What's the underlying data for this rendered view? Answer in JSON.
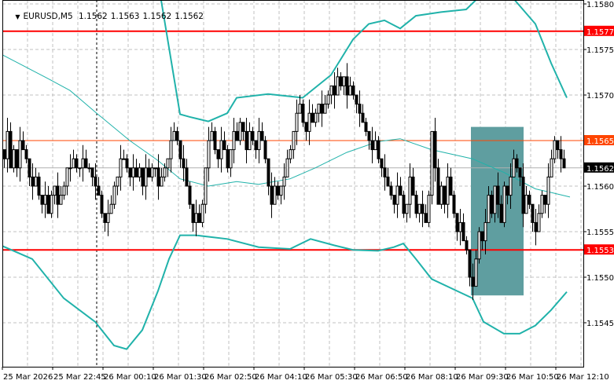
{
  "header": {
    "menu_icon": "triangle-down-icon",
    "symbol": "EURUSD,M5",
    "open": "1.1562",
    "high": "1.1563",
    "low": "1.1562",
    "close": "1.1562"
  },
  "chart_data": {
    "type": "candlestick",
    "symbol": "EURUSD",
    "timeframe": "M5",
    "ylim": [
      1.15403,
      1.15804
    ],
    "y_ticks": [
      "1.1580",
      "1.1575",
      "1.1570",
      "1.1560",
      "1.1555",
      "1.1550",
      "1.1545"
    ],
    "y_tick_values": [
      1.158,
      1.1575,
      1.157,
      1.156,
      1.1555,
      1.155,
      1.1545
    ],
    "x_ticks": [
      "25 Mar 2026",
      "25 Mar 22:45",
      "26 Mar 00:10",
      "26 Mar 01:30",
      "26 Mar 02:50",
      "26 Mar 04:10",
      "26 Mar 05:30",
      "26 Mar 06:50",
      "26 Mar 08:10",
      "26 Mar 09:30",
      "26 Mar 10:50",
      "26 Mar 12:10"
    ],
    "x_tick_bar_step": 16,
    "grid": true,
    "closes": [
      1.1563,
      1.1566,
      1.1562,
      1.1564,
      1.1562,
      1.1565,
      1.1564,
      1.1563,
      1.1561,
      1.156,
      1.1561,
      1.1559,
      1.1558,
      1.1559,
      1.1557,
      1.1559,
      1.156,
      1.1558,
      1.1559,
      1.156,
      1.1562,
      1.1562,
      1.1563,
      1.1562,
      1.1562,
      1.1563,
      1.1562,
      1.1562,
      1.1561,
      1.156,
      1.1559,
      1.1557,
      1.1556,
      1.1557,
      1.1558,
      1.156,
      1.1561,
      1.1563,
      1.1563,
      1.1562,
      1.1561,
      1.1562,
      1.1561,
      1.1562,
      1.156,
      1.1562,
      1.1561,
      1.1562,
      1.1562,
      1.156,
      1.1561,
      1.1562,
      1.1563,
      1.1565,
      1.1566,
      1.1565,
      1.1563,
      1.1562,
      1.156,
      1.1558,
      1.1556,
      1.1557,
      1.1556,
      1.1558,
      1.1562,
      1.1565,
      1.1566,
      1.1564,
      1.1563,
      1.1565,
      1.1564,
      1.1562,
      1.1564,
      1.1566,
      1.1565,
      1.1567,
      1.1566,
      1.1564,
      1.1566,
      1.1565,
      1.1564,
      1.1566,
      1.1565,
      1.1563,
      1.156,
      1.1558,
      1.156,
      1.1559,
      1.156,
      1.1561,
      1.1563,
      1.1564,
      1.1566,
      1.1568,
      1.1569,
      1.1567,
      1.1566,
      1.1568,
      1.1567,
      1.1568,
      1.1569,
      1.1568,
      1.1569,
      1.157,
      1.1571,
      1.157,
      1.1572,
      1.1571,
      1.1572,
      1.157,
      1.1571,
      1.157,
      1.1569,
      1.1568,
      1.1567,
      1.1566,
      1.1565,
      1.1564,
      1.1565,
      1.1563,
      1.1562,
      1.1561,
      1.156,
      1.1559,
      1.1558,
      1.156,
      1.1559,
      1.1557,
      1.1558,
      1.1561,
      1.1559,
      1.1557,
      1.1558,
      1.1557,
      1.1556,
      1.1559,
      1.1566,
      1.1562,
      1.1558,
      1.156,
      1.1558,
      1.1561,
      1.1559,
      1.1557,
      1.1555,
      1.1556,
      1.1554,
      1.1553,
      1.155,
      1.1549,
      1.1552,
      1.1555,
      1.1554,
      1.1556,
      1.1559,
      1.1557,
      1.156,
      1.1558,
      1.1556,
      1.156,
      1.1559,
      1.1561,
      1.1563,
      1.1562,
      1.1561,
      1.1557,
      1.1559,
      1.1558,
      1.1556,
      1.1555,
      1.1557,
      1.1559,
      1.1558,
      1.1561,
      1.1563,
      1.1565,
      1.1564,
      1.1563,
      1.1562
    ],
    "bollinger": {
      "upper": [
        [
          47.5,
          1.1582
        ],
        [
          50,
          1.15804
        ],
        [
          56,
          1.15679
        ],
        [
          59,
          1.15676
        ],
        [
          65,
          1.15671
        ],
        [
          71,
          1.1568
        ],
        [
          74,
          1.15697
        ],
        [
          84,
          1.15701
        ],
        [
          95,
          1.15697
        ],
        [
          104,
          1.15722
        ],
        [
          111,
          1.15761
        ],
        [
          116,
          1.15778
        ],
        [
          121,
          1.15782
        ],
        [
          126,
          1.15773
        ],
        [
          131,
          1.15787
        ],
        [
          139,
          1.15791
        ],
        [
          147,
          1.15794
        ],
        [
          150,
          1.15804
        ],
        [
          151,
          1.1582
        ],
        [
          161,
          1.1582
        ],
        [
          162.5,
          1.15804
        ],
        [
          169,
          1.15778
        ],
        [
          174,
          1.15735
        ],
        [
          179,
          1.15697
        ]
      ],
      "middle": [
        [
          -1,
          1.15745
        ],
        [
          4,
          1.15736
        ],
        [
          14,
          1.15718
        ],
        [
          21,
          1.15705
        ],
        [
          29.5,
          1.1568
        ],
        [
          40,
          1.1565
        ],
        [
          49,
          1.15628
        ],
        [
          56,
          1.15608
        ],
        [
          65,
          1.156
        ],
        [
          74,
          1.15605
        ],
        [
          81,
          1.15602
        ],
        [
          91,
          1.15608
        ],
        [
          99,
          1.1562
        ],
        [
          109,
          1.15637
        ],
        [
          119,
          1.15649
        ],
        [
          126,
          1.15652
        ],
        [
          136,
          1.1564
        ],
        [
          149,
          1.1563
        ],
        [
          159,
          1.15615
        ],
        [
          169,
          1.15597
        ],
        [
          174,
          1.15593
        ],
        [
          180,
          1.15588
        ]
      ],
      "lower": [
        [
          -1,
          1.15535
        ],
        [
          9,
          1.1552
        ],
        [
          19,
          1.15477
        ],
        [
          29,
          1.15451
        ],
        [
          35,
          1.15425
        ],
        [
          39,
          1.15421
        ],
        [
          44,
          1.15442
        ],
        [
          49,
          1.15485
        ],
        [
          52.5,
          1.1552
        ],
        [
          56,
          1.15546
        ],
        [
          61,
          1.15546
        ],
        [
          71,
          1.15542
        ],
        [
          81,
          1.15533
        ],
        [
          91,
          1.15531
        ],
        [
          97.5,
          1.15542
        ],
        [
          105,
          1.15535
        ],
        [
          111,
          1.1553
        ],
        [
          119,
          1.15529
        ],
        [
          124,
          1.15533
        ],
        [
          127,
          1.15537
        ],
        [
          131,
          1.1552
        ],
        [
          136,
          1.15498
        ],
        [
          144,
          1.15485
        ],
        [
          149,
          1.15477
        ],
        [
          152.5,
          1.15451
        ],
        [
          159,
          1.15438
        ],
        [
          164,
          1.15438
        ],
        [
          169,
          1.15447
        ],
        [
          174,
          1.15464
        ],
        [
          179,
          1.15484
        ]
      ]
    },
    "levels": [
      {
        "price": 1.1577,
        "label": "1.1577",
        "color": "#ff0000",
        "kind": "resistance"
      },
      {
        "price": 1.1565,
        "label": "1.1565",
        "color": "#ff4500",
        "kind": "level"
      },
      {
        "price": 1.1562,
        "label": "1.1562",
        "color": "#000000",
        "kind": "bid"
      },
      {
        "price": 1.1553,
        "label": "1.1553",
        "color": "#ff0000",
        "kind": "support"
      }
    ],
    "rectangle": {
      "from_bar": 148.5,
      "to_bar": 165.25,
      "top": 1.15665,
      "bottom": 1.1548,
      "color": "#5f9ea0"
    },
    "vline_bar": 29.5,
    "colors": {
      "band": "#20b2aa",
      "grid": "#c0c0c0",
      "bull": "#ffffff",
      "bear": "#000000"
    }
  }
}
